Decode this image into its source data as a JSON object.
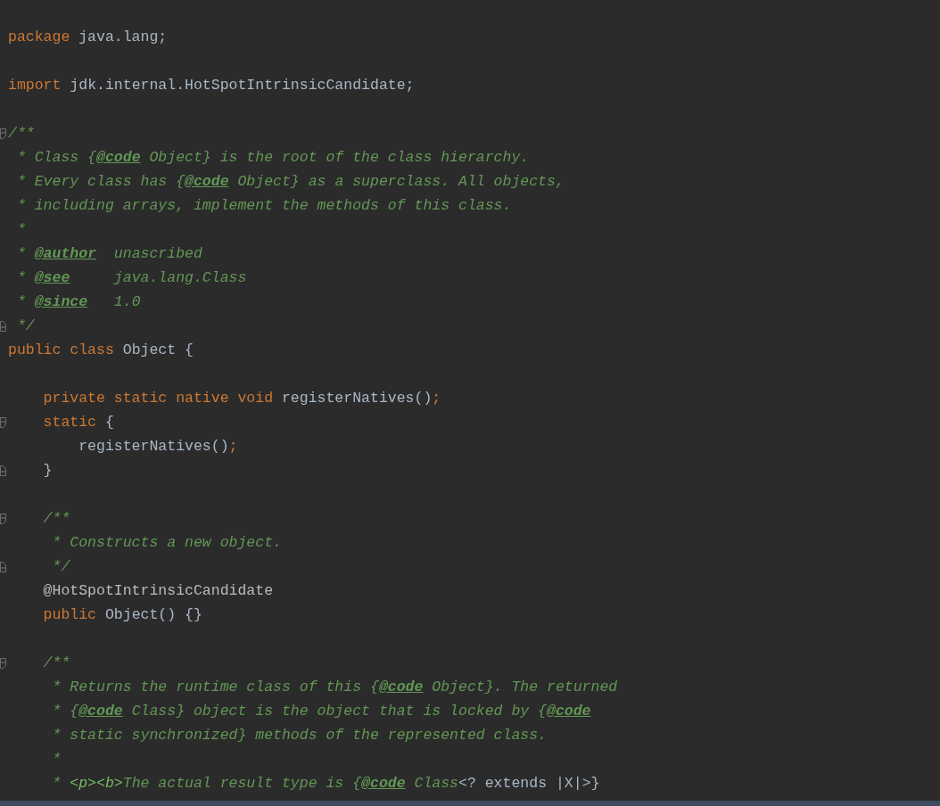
{
  "editor": {
    "lines": [
      {
        "kind": "blank"
      },
      {
        "kind": "code",
        "tokens": [
          {
            "text": "package",
            "kind": "kw"
          },
          {
            "text": " java.lang;",
            "kind": "plain"
          }
        ]
      },
      {
        "kind": "blank"
      },
      {
        "kind": "code",
        "tokens": [
          {
            "text": "import",
            "kind": "kw"
          },
          {
            "text": " jdk.internal.HotSpotIntrinsicCandidate;",
            "kind": "plain"
          }
        ]
      },
      {
        "kind": "blank"
      },
      {
        "kind": "code",
        "fold_start": true,
        "tokens": [
          {
            "text": "/**",
            "kind": "doc"
          }
        ]
      },
      {
        "kind": "code",
        "tokens": [
          {
            "text": " * Class {",
            "kind": "doc"
          },
          {
            "text": "@code",
            "kind": "tag"
          },
          {
            "text": " Object} is the root of the class hierarchy.",
            "kind": "doc"
          }
        ]
      },
      {
        "kind": "code",
        "tokens": [
          {
            "text": " * Every class has {",
            "kind": "doc"
          },
          {
            "text": "@code",
            "kind": "tag"
          },
          {
            "text": " Object} as a superclass. All objects,",
            "kind": "doc"
          }
        ]
      },
      {
        "kind": "code",
        "tokens": [
          {
            "text": " * including arrays, implement the methods of this class.",
            "kind": "doc"
          }
        ]
      },
      {
        "kind": "code",
        "tokens": [
          {
            "text": " *",
            "kind": "doc"
          }
        ]
      },
      {
        "kind": "code",
        "tokens": [
          {
            "text": " * ",
            "kind": "doc"
          },
          {
            "text": "@author",
            "kind": "tag"
          },
          {
            "text": "  unascribed",
            "kind": "doc"
          }
        ]
      },
      {
        "kind": "code",
        "tokens": [
          {
            "text": " * ",
            "kind": "doc"
          },
          {
            "text": "@see",
            "kind": "tag"
          },
          {
            "text": "     java.lang.Class",
            "kind": "doc"
          }
        ]
      },
      {
        "kind": "code",
        "tokens": [
          {
            "text": " * ",
            "kind": "doc"
          },
          {
            "text": "@since",
            "kind": "tag"
          },
          {
            "text": "   1.0",
            "kind": "doc"
          }
        ]
      },
      {
        "kind": "code",
        "fold_end": true,
        "tokens": [
          {
            "text": " */",
            "kind": "doc"
          }
        ]
      },
      {
        "kind": "code",
        "tokens": [
          {
            "text": "public class",
            "kind": "kw"
          },
          {
            "text": " Object {",
            "kind": "plain"
          }
        ]
      },
      {
        "kind": "blank"
      },
      {
        "kind": "code",
        "tokens": [
          {
            "text": "    private static native void",
            "kind": "kw"
          },
          {
            "text": " registerNatives()",
            "kind": "plain"
          },
          {
            "text": ";",
            "kind": "kw"
          }
        ]
      },
      {
        "kind": "code",
        "fold_start": true,
        "tokens": [
          {
            "text": "    static",
            "kind": "kw"
          },
          {
            "text": " {",
            "kind": "plain"
          }
        ]
      },
      {
        "kind": "code",
        "tokens": [
          {
            "text": "        registerNatives()",
            "kind": "plain"
          },
          {
            "text": ";",
            "kind": "kw"
          }
        ]
      },
      {
        "kind": "code",
        "fold_end": true,
        "tokens": [
          {
            "text": "    }",
            "kind": "plain"
          }
        ]
      },
      {
        "kind": "blank"
      },
      {
        "kind": "code",
        "fold_start": true,
        "tokens": [
          {
            "text": "    /**",
            "kind": "doc"
          }
        ]
      },
      {
        "kind": "code",
        "tokens": [
          {
            "text": "     * Constructs a new object.",
            "kind": "doc"
          }
        ]
      },
      {
        "kind": "code",
        "fold_end": true,
        "tokens": [
          {
            "text": "     */",
            "kind": "doc"
          }
        ]
      },
      {
        "kind": "code",
        "tokens": [
          {
            "text": "    @HotSpotIntrinsicCandidate",
            "kind": "ann"
          }
        ]
      },
      {
        "kind": "code",
        "tokens": [
          {
            "text": "    public",
            "kind": "kw"
          },
          {
            "text": " Object() {}",
            "kind": "plain"
          }
        ]
      },
      {
        "kind": "blank"
      },
      {
        "kind": "code",
        "fold_start": true,
        "tokens": [
          {
            "text": "    /**",
            "kind": "doc"
          }
        ]
      },
      {
        "kind": "code",
        "tokens": [
          {
            "text": "     * Returns the runtime class of this {",
            "kind": "doc"
          },
          {
            "text": "@code",
            "kind": "tag"
          },
          {
            "text": " Object}. The returned",
            "kind": "doc"
          }
        ]
      },
      {
        "kind": "code",
        "tokens": [
          {
            "text": "     * {",
            "kind": "doc"
          },
          {
            "text": "@code",
            "kind": "tag"
          },
          {
            "text": " Class} object is the object that is locked by {",
            "kind": "doc"
          },
          {
            "text": "@code",
            "kind": "tag"
          }
        ]
      },
      {
        "kind": "code",
        "tokens": [
          {
            "text": "     * static synchronized} methods of the represented class.",
            "kind": "doc"
          }
        ]
      },
      {
        "kind": "code",
        "tokens": [
          {
            "text": "     *",
            "kind": "doc"
          }
        ]
      },
      {
        "kind": "code",
        "tokens": [
          {
            "text": "     * ",
            "kind": "doc"
          },
          {
            "text": "<p><b>",
            "kind": "html"
          },
          {
            "text": "The actual result type is {",
            "kind": "doc"
          },
          {
            "text": "@code",
            "kind": "tag"
          },
          {
            "text": " Class",
            "kind": "doc"
          },
          {
            "text": "<? extends |X|>}",
            "kind": "plain"
          }
        ]
      }
    ]
  }
}
